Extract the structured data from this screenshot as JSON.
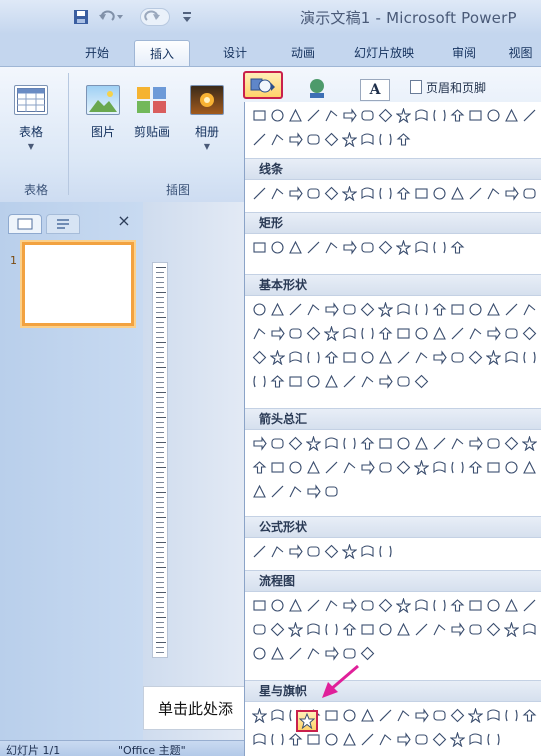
{
  "window": {
    "title": "演示文稿1 - Microsoft PowerP"
  },
  "tabs": [
    "开始",
    "插入",
    "设计",
    "动画",
    "幻灯片放映",
    "审阅",
    "视图"
  ],
  "active_tab_index": 1,
  "ribbon": {
    "table_button": "表格",
    "picture_button": "图片",
    "clipart_button": "剪贴画",
    "album_button": "相册",
    "textbox_button": "A",
    "header_footer_button": "页眉和页脚",
    "group_table": "表格",
    "group_images": "插图"
  },
  "shapes_menu": {
    "sections": [
      "线条",
      "矩形",
      "基本形状",
      "箭头总汇",
      "公式形状",
      "流程图",
      "星与旗帜"
    ],
    "selected_shape": "5-point-star"
  },
  "slide_panel": {
    "slide_number": "1",
    "close_label": "×"
  },
  "editor": {
    "placeholder": "单击此处添"
  },
  "status": {
    "slide": "幻灯片 1/1",
    "theme": "\"Office 主题\""
  },
  "colors": {
    "accent_highlight": "#c9204c",
    "hover_fill": "#ffd36a",
    "ribbon_blue": "#c4d6ee",
    "arrow": "#e0209a"
  }
}
